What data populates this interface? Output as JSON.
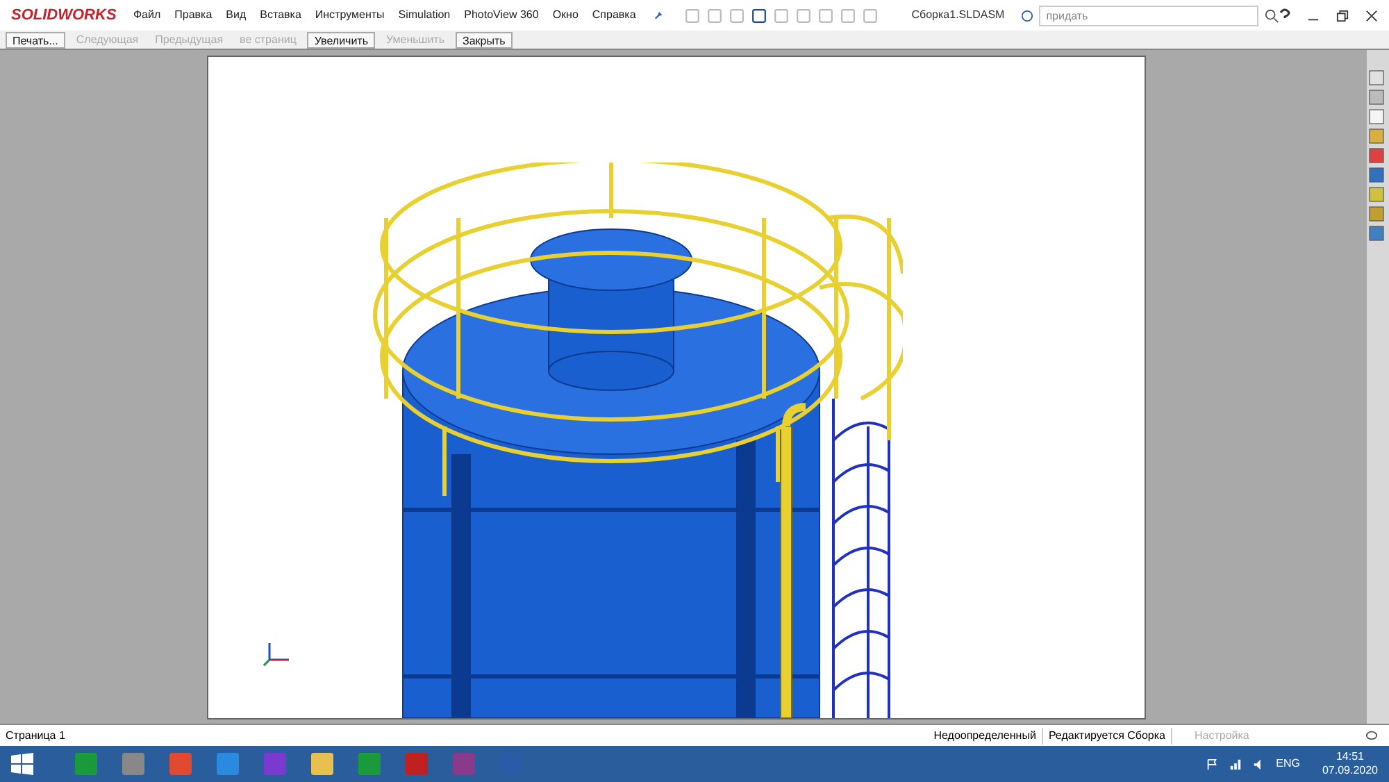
{
  "app": {
    "logo": "SOLIDWORKS",
    "menu": [
      "Файл",
      "Правка",
      "Вид",
      "Вставка",
      "Инструменты",
      "Simulation",
      "PhotoView 360",
      "Окно",
      "Справка"
    ],
    "document_title": "Сборка1.SLDASM",
    "search": {
      "placeholder": "придать"
    }
  },
  "preview_toolbar": [
    {
      "label": "Печать...",
      "disabled": false
    },
    {
      "label": "Следующая",
      "disabled": true
    },
    {
      "label": "Предыдущая",
      "disabled": true
    },
    {
      "label": "ве страниц",
      "disabled": true
    },
    {
      "label": "Увеличить",
      "disabled": false
    },
    {
      "label": "Уменьшить",
      "disabled": true
    },
    {
      "label": "Закрыть",
      "disabled": false
    }
  ],
  "status_bar": {
    "page": "Страница 1",
    "state": "Недоопределенный",
    "mode": "Редактируется Сборка",
    "settings": "Настройка"
  },
  "taskbar": {
    "language": "ENG",
    "time": "14:51",
    "date": "07.09.2020"
  }
}
